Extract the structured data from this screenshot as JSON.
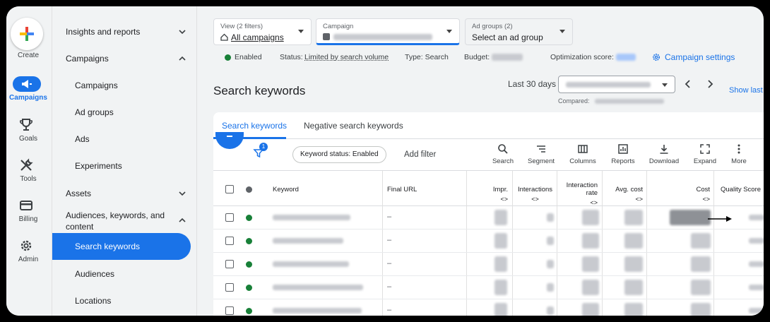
{
  "rail": {
    "create": "Create",
    "campaigns": "Campaigns",
    "goals": "Goals",
    "tools": "Tools",
    "billing": "Billing",
    "admin": "Admin"
  },
  "nav": {
    "insights": "Insights and reports",
    "campaigns_section": "Campaigns",
    "campaigns": "Campaigns",
    "ad_groups": "Ad groups",
    "ads": "Ads",
    "experiments": "Experiments",
    "assets": "Assets",
    "audiences_keywords_line1": "Audiences, keywords, and",
    "audiences_keywords_line2": "content",
    "search_keywords": "Search keywords",
    "audiences": "Audiences",
    "locations": "Locations"
  },
  "filters": {
    "view_small": "View (2 filters)",
    "view_big": "All campaigns",
    "campaign_small": "Campaign",
    "adgroups_small": "Ad groups (2)",
    "adgroups_big": "Select an ad group"
  },
  "status": {
    "enabled": "Enabled",
    "status_label": "Status:",
    "status_value": "Limited by search volume",
    "type": "Type: Search",
    "budget": "Budget:",
    "opt_score": "Optimization score:",
    "settings": "Campaign settings"
  },
  "page": {
    "title": "Search keywords",
    "date_range_label": "Last 30 days",
    "compared": "Compared:",
    "show_last": "Show last"
  },
  "tabs": {
    "search_keywords": "Search keywords",
    "negative": "Negative search keywords"
  },
  "toolbar": {
    "filter_badge": "1",
    "chip": "Keyword status: Enabled",
    "add_filter": "Add filter",
    "search": "Search",
    "segment": "Segment",
    "columns": "Columns",
    "reports": "Reports",
    "download": "Download",
    "expand": "Expand",
    "more": "More"
  },
  "table": {
    "headers": {
      "keyword": "Keyword",
      "final_url": "Final URL",
      "impr": "Impr.",
      "interactions": "Interactions",
      "interaction_rate_1": "Interaction",
      "interaction_rate_2": "rate",
      "avg_cost": "Avg. cost",
      "cost": "Cost",
      "quality": "Quality Score"
    },
    "sort_glyph": "<>",
    "final_url_value": "–",
    "row_count": 5
  },
  "colors": {
    "accent": "#1a73e8",
    "enabled_green": "#188038"
  }
}
